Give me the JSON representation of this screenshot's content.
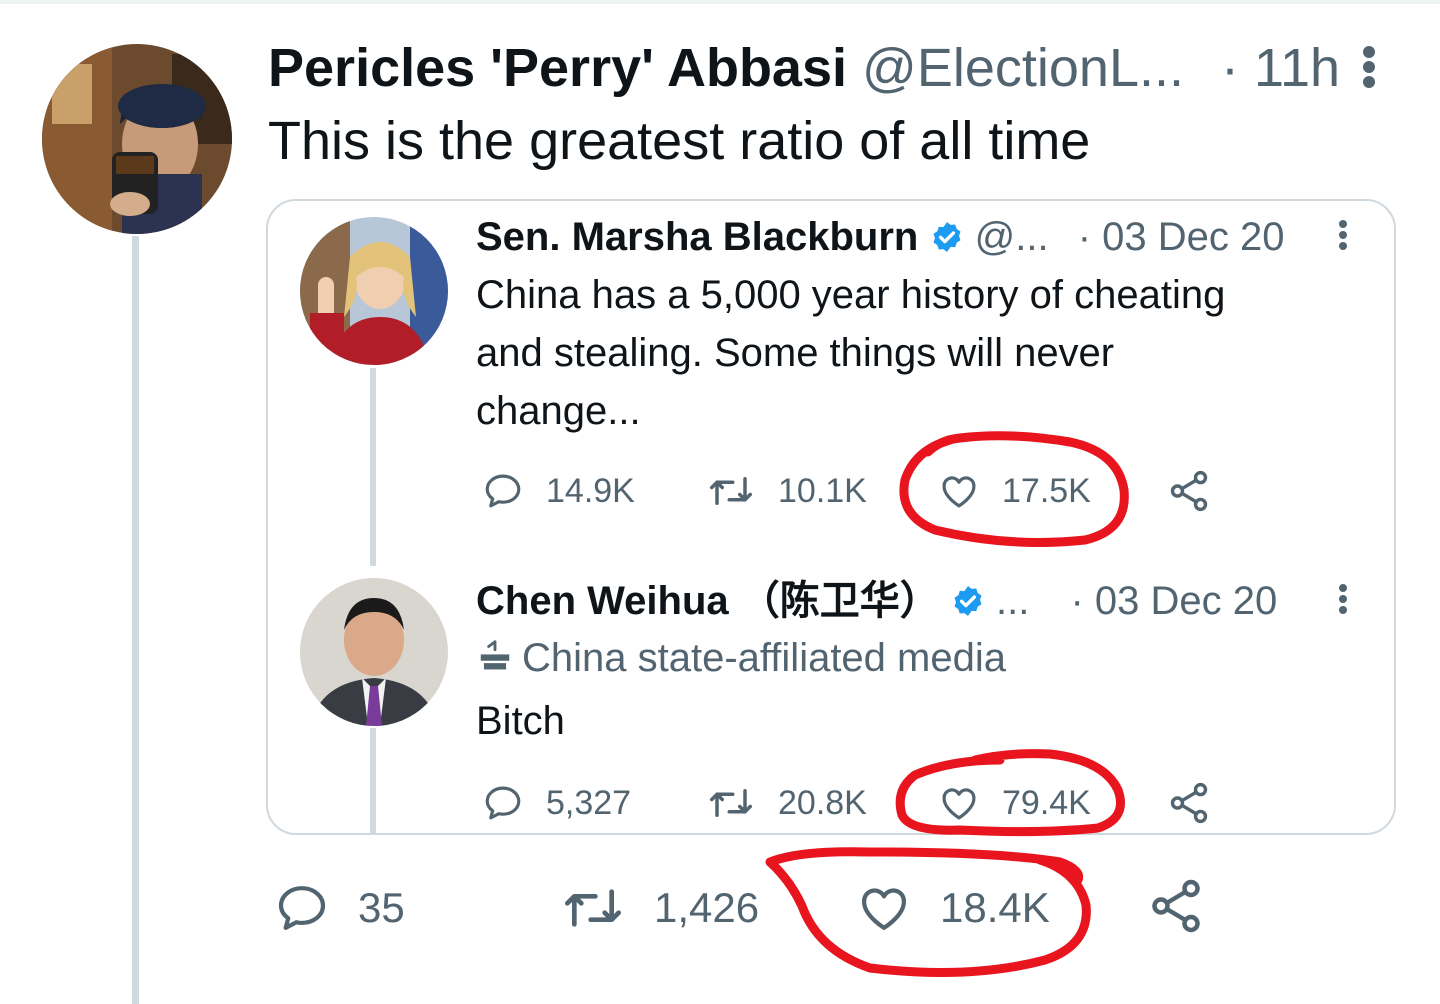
{
  "tweet": {
    "author_name": "Pericles 'Perry' Abbasi",
    "handle": "@ElectionL...",
    "time": "· 11h",
    "text": "This is the greatest ratio of all time",
    "stats": {
      "replies": "35",
      "retweets": "1,426",
      "likes": "18.4K"
    }
  },
  "quoted": [
    {
      "author_name": "Sen. Marsha Blackburn",
      "handle": "@...",
      "time": "· 03 Dec 20",
      "text_lines": [
        "China has a 5,000 year history of cheating",
        "and stealing. Some things will never",
        "change..."
      ],
      "stats": {
        "replies": "14.9K",
        "retweets": "10.1K",
        "likes": "17.5K"
      }
    },
    {
      "author_name": "Chen Weihua （陈卫华）",
      "handle": "...",
      "time": "· 03 Dec 20",
      "label": "China state-affiliated media",
      "text": "Bitch",
      "stats": {
        "replies": "5,327",
        "retweets": "20.8K",
        "likes": "79.4K"
      }
    }
  ],
  "colors": {
    "verified": "#1d9bf0",
    "muted": "#536471",
    "annotation": "#e8141e"
  }
}
